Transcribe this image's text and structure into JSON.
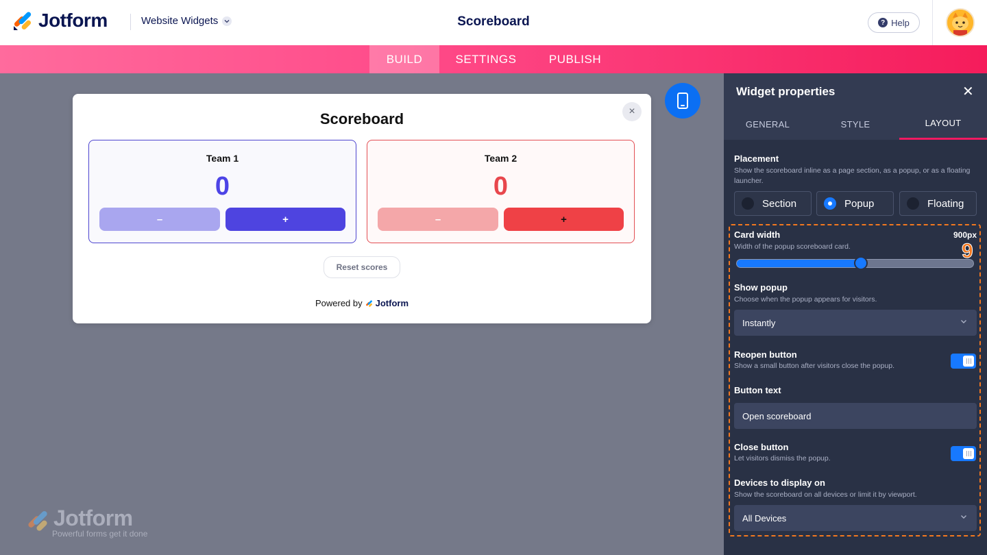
{
  "header": {
    "brand": "Jotform",
    "product": "Website Widgets",
    "title": "Scoreboard",
    "help_label": "Help"
  },
  "nav": {
    "tabs": [
      {
        "label": "BUILD",
        "active": true
      },
      {
        "label": "SETTINGS",
        "active": false
      },
      {
        "label": "PUBLISH",
        "active": false
      }
    ]
  },
  "preview": {
    "card_title": "Scoreboard",
    "close_glyph": "×",
    "teams": [
      {
        "name": "Team 1",
        "score": "0",
        "minus": "–",
        "plus": "+",
        "color": "#4d44e6"
      },
      {
        "name": "Team 2",
        "score": "0",
        "minus": "–",
        "plus": "+",
        "color": "#e8474d"
      }
    ],
    "reset_label": "Reset scores",
    "powered_prefix": "Powered by",
    "powered_brand": "Jotform"
  },
  "watermark": {
    "brand": "Jotform",
    "tagline": "Powerful forms get it done"
  },
  "panel": {
    "title": "Widget properties",
    "close_glyph": "✕",
    "tabs": [
      {
        "label": "GENERAL",
        "active": false
      },
      {
        "label": "STYLE",
        "active": false
      },
      {
        "label": "LAYOUT",
        "active": true
      }
    ],
    "placement": {
      "label": "Placement",
      "description": "Show the scoreboard inline as a page section, as a popup, or as a floating launcher.",
      "options": [
        {
          "label": "Section",
          "checked": false
        },
        {
          "label": "Popup",
          "checked": true
        },
        {
          "label": "Floating",
          "checked": false
        }
      ]
    },
    "annotation_number": "9",
    "card_width": {
      "label": "Card width",
      "description": "Width of the popup scoreboard card.",
      "value": "900px",
      "slider_fraction": 0.53
    },
    "show_popup": {
      "label": "Show popup",
      "description": "Choose when the popup appears for visitors.",
      "selected": "Instantly"
    },
    "reopen_button": {
      "label": "Reopen button",
      "description": "Show a small button after visitors close the popup.",
      "enabled": true
    },
    "button_text": {
      "label": "Button text",
      "value": "Open scoreboard"
    },
    "close_button": {
      "label": "Close button",
      "description": "Let visitors dismiss the popup.",
      "enabled": true
    },
    "devices": {
      "label": "Devices to display on",
      "description": "Show the scoreboard on all devices or limit it by viewport.",
      "selected": "All Devices"
    }
  },
  "colors": {
    "accent_pink": "#f01a61",
    "primary_blue": "#1779ff",
    "annotation_orange": "#f3781f"
  }
}
